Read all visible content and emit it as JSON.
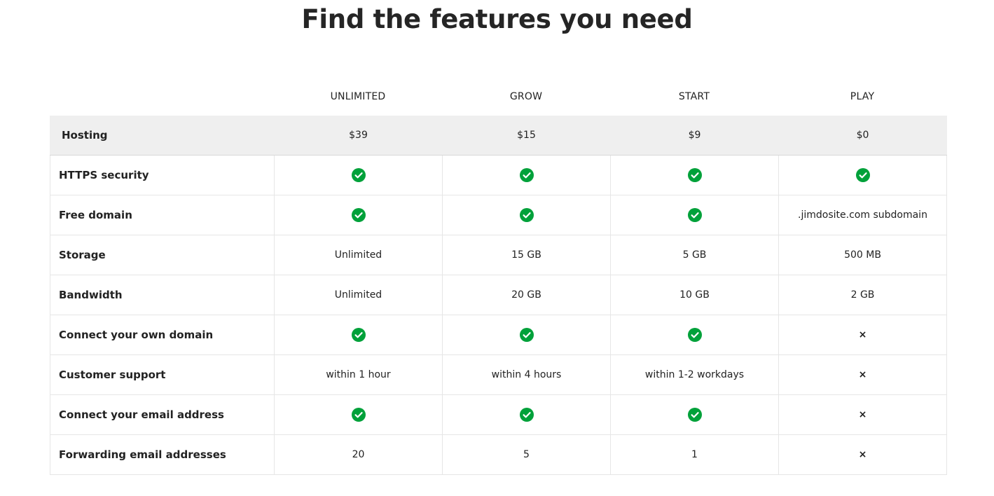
{
  "page": {
    "title": "Find the features you need"
  },
  "plans": [
    "UNLIMITED",
    "GROW",
    "START",
    "PLAY"
  ],
  "colors": {
    "check": "#00a13a",
    "hosting_row_bg": "#efefef",
    "border": "#e6e6e6"
  },
  "rows": [
    {
      "label": "Hosting",
      "values": [
        "$39",
        "$15",
        "$9",
        "$0"
      ]
    },
    {
      "label": "HTTPS security",
      "values": [
        "check-icon",
        "check-icon",
        "check-icon",
        "check-icon"
      ]
    },
    {
      "label": "Free domain",
      "values": [
        "check-icon",
        "check-icon",
        "check-icon",
        ".jimdosite.com subdomain"
      ]
    },
    {
      "label": "Storage",
      "values": [
        "Unlimited",
        "15 GB",
        "5 GB",
        "500 MB"
      ]
    },
    {
      "label": "Bandwidth",
      "values": [
        "Unlimited",
        "20 GB",
        "10 GB",
        "2 GB"
      ]
    },
    {
      "label": "Connect your own domain",
      "values": [
        "check-icon",
        "check-icon",
        "check-icon",
        "×"
      ]
    },
    {
      "label": "Customer support",
      "values": [
        "within 1 hour",
        "within 4 hours",
        "within 1-2 workdays",
        "×"
      ]
    },
    {
      "label": "Connect your email address",
      "values": [
        "check-icon",
        "check-icon",
        "check-icon",
        "×"
      ]
    },
    {
      "label": "Forwarding email addresses",
      "values": [
        "20",
        "5",
        "1",
        "×"
      ]
    }
  ]
}
